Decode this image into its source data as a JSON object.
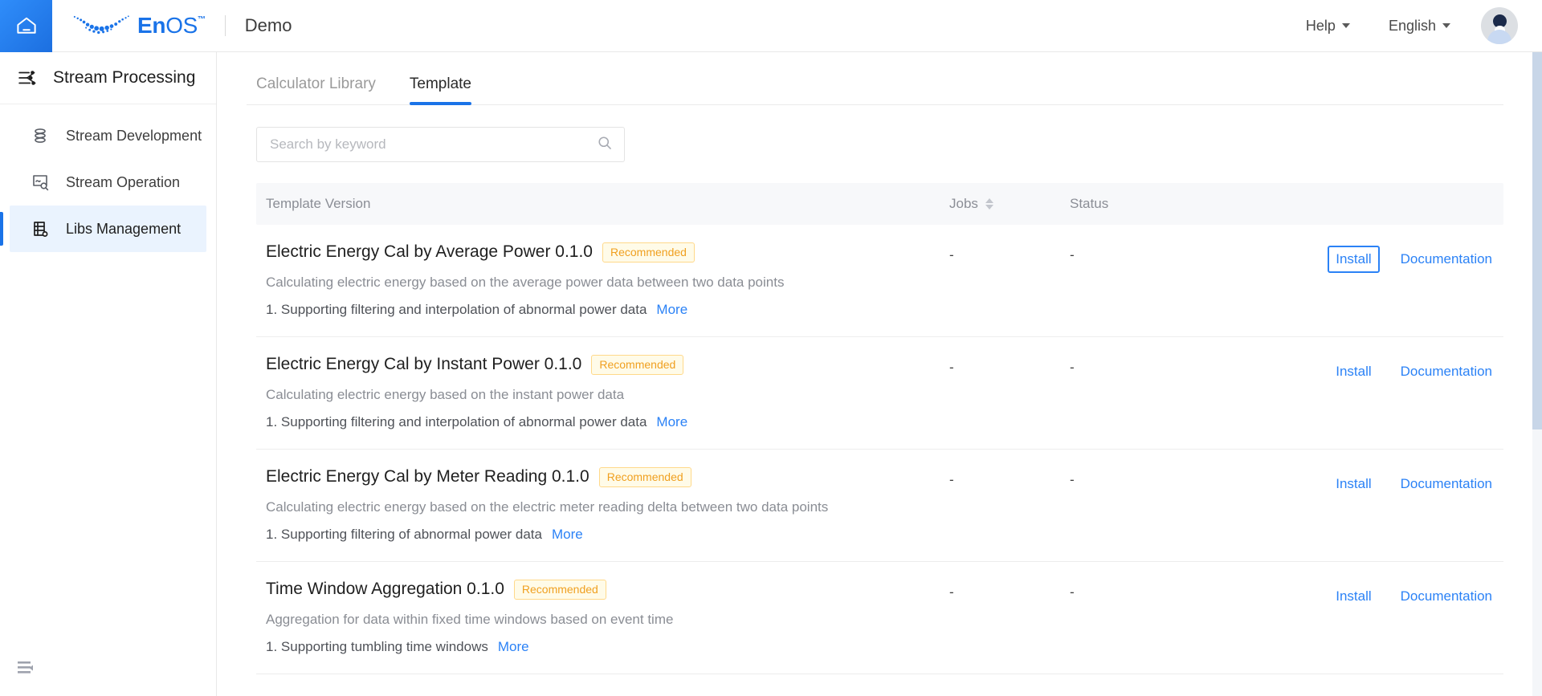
{
  "topbar": {
    "home_icon": "home-icon",
    "brand": {
      "en": "En",
      "os": "OS",
      "tm": "™"
    },
    "tenant": "Demo",
    "help_label": "Help",
    "language_label": "English",
    "avatar": "user-avatar"
  },
  "sidebar": {
    "title": "Stream Processing",
    "items": [
      {
        "label": "Stream Development",
        "icon": "stream-development-icon",
        "active": false
      },
      {
        "label": "Stream Operation",
        "icon": "stream-operation-icon",
        "active": false
      },
      {
        "label": "Libs Management",
        "icon": "libs-management-icon",
        "active": true
      }
    ],
    "collapse_icon": "collapse-sidebar-icon"
  },
  "tabs": [
    {
      "label": "Calculator Library",
      "active": false
    },
    {
      "label": "Template",
      "active": true
    }
  ],
  "search": {
    "placeholder": "Search by keyword",
    "value": "",
    "icon": "search-icon"
  },
  "table": {
    "columns": {
      "name": "Template Version",
      "jobs": "Jobs",
      "status": "Status",
      "actions": ""
    },
    "jobs_sortable": true,
    "rows": [
      {
        "title": "Electric Energy Cal by Average Power 0.1.0",
        "badge": "Recommended",
        "description": "Calculating electric energy based on the average power data between two data points",
        "feature": "1. Supporting filtering and interpolation of abnormal power data",
        "more": "More",
        "jobs": "-",
        "status": "-",
        "install": "Install",
        "documentation": "Documentation",
        "install_focused": true
      },
      {
        "title": "Electric Energy Cal by Instant Power 0.1.0",
        "badge": "Recommended",
        "description": "Calculating electric energy based on the instant power data",
        "feature": "1. Supporting filtering and interpolation of abnormal power data",
        "more": "More",
        "jobs": "-",
        "status": "-",
        "install": "Install",
        "documentation": "Documentation",
        "install_focused": false
      },
      {
        "title": "Electric Energy Cal by Meter Reading 0.1.0",
        "badge": "Recommended",
        "description": "Calculating electric energy based on the electric meter reading delta between two data points",
        "feature": "1. Supporting filtering of abnormal power data",
        "more": "More",
        "jobs": "-",
        "status": "-",
        "install": "Install",
        "documentation": "Documentation",
        "install_focused": false
      },
      {
        "title": "Time Window Aggregation 0.1.0",
        "badge": "Recommended",
        "description": "Aggregation for data within fixed time windows based on event time",
        "feature": "1. Supporting tumbling time windows",
        "more": "More",
        "jobs": "-",
        "status": "-",
        "install": "Install",
        "documentation": "Documentation",
        "install_focused": false
      }
    ]
  },
  "colors": {
    "accent": "#1a73e8",
    "link": "#2b82f6",
    "badge_text": "#f0a020",
    "badge_border": "#ffd98a",
    "badge_bg": "#fffbe8",
    "header_bg": "#f7f8fa",
    "active_nav_bg": "#eaf3fe"
  }
}
